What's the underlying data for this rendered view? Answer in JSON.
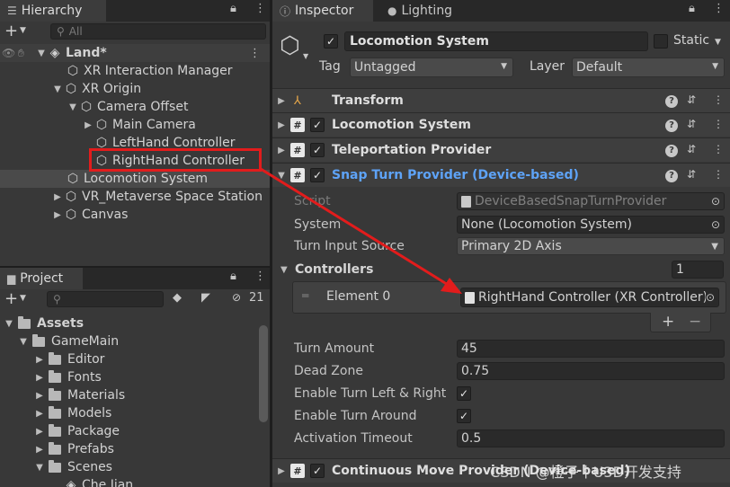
{
  "hierarchy": {
    "tab_label": "Hierarchy",
    "search_placeholder": "All",
    "scene_name": "Land*",
    "items": [
      {
        "label": "XR Interaction Manager"
      },
      {
        "label": "XR Origin"
      },
      {
        "label": "Camera Offset"
      },
      {
        "label": "Main Camera"
      },
      {
        "label": "LeftHand Controller"
      },
      {
        "label": "RightHand Controller"
      },
      {
        "label": "Locomotion System"
      },
      {
        "label": "VR_Metaverse Space Station"
      },
      {
        "label": "Canvas"
      }
    ]
  },
  "project": {
    "tab_label": "Project",
    "hidden_count": "21",
    "items": [
      {
        "label": "Assets"
      },
      {
        "label": "GameMain"
      },
      {
        "label": "Editor"
      },
      {
        "label": "Fonts"
      },
      {
        "label": "Materials"
      },
      {
        "label": "Models"
      },
      {
        "label": "Package"
      },
      {
        "label": "Prefabs"
      },
      {
        "label": "Scenes"
      },
      {
        "label": "Che Jian"
      }
    ]
  },
  "inspector": {
    "tab_label": "Inspector",
    "lighting_tab_label": "Lighting",
    "object_name": "Locomotion System",
    "static_label": "Static",
    "tag_label": "Tag",
    "tag_value": "Untagged",
    "layer_label": "Layer",
    "layer_value": "Default",
    "components": [
      {
        "name": "Transform"
      },
      {
        "name": "Locomotion System"
      },
      {
        "name": "Teleportation Provider"
      },
      {
        "name": "Snap Turn Provider (Device-based)"
      },
      {
        "name": "Continuous Move Provider (Device-based)"
      }
    ],
    "properties": {
      "script_label": "Script",
      "script_value": "DeviceBasedSnapTurnProvider",
      "system_label": "System",
      "system_value": "None (Locomotion System)",
      "turn_input_label": "Turn Input Source",
      "turn_input_value": "Primary 2D Axis",
      "controllers_label": "Controllers",
      "controllers_count": "1",
      "element0_label": "Element 0",
      "element0_value": "RightHand Controller (XR Controller)",
      "turn_amount_label": "Turn Amount",
      "turn_amount_value": "45",
      "dead_zone_label": "Dead Zone",
      "dead_zone_value": "0.75",
      "enable_turn_lr_label": "Enable Turn Left & Right",
      "enable_turn_around_label": "Enable Turn Around",
      "activation_timeout_label": "Activation Timeout",
      "activation_timeout_value": "0.5"
    }
  },
  "watermark": "CSDN @橙子丨U3D开发支持",
  "colors": {
    "panel": "#383838",
    "accent_link": "#5ea3f7",
    "highlight_box": "#e21c1c"
  }
}
